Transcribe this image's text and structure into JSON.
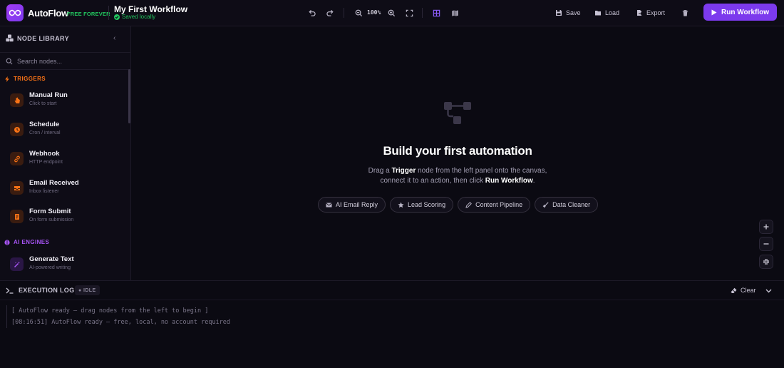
{
  "app": {
    "name": "AutoFlow",
    "tag": "FREE FOREVER"
  },
  "workflow": {
    "title": "My First Workflow",
    "status": "Saved locally"
  },
  "toolbar": {
    "zoom": "100%",
    "save": "Save",
    "load": "Load",
    "export": "Export",
    "run": "Run Workflow"
  },
  "sidebar": {
    "title": "NODE LIBRARY",
    "search_placeholder": "Search nodes...",
    "sections": [
      {
        "title": "TRIGGERS",
        "color": "#f97316",
        "nodes": [
          {
            "title": "Manual Run",
            "subtitle": "Click to start",
            "icon": "hand-pointer-icon"
          },
          {
            "title": "Schedule",
            "subtitle": "Cron / interval",
            "icon": "clock-icon"
          },
          {
            "title": "Webhook",
            "subtitle": "HTTP endpoint",
            "icon": "link-icon"
          },
          {
            "title": "Email Received",
            "subtitle": "Inbox listener",
            "icon": "inbox-icon"
          },
          {
            "title": "Form Submit",
            "subtitle": "On form submission",
            "icon": "form-icon"
          }
        ]
      },
      {
        "title": "AI ENGINES",
        "color": "#a855f7",
        "nodes": [
          {
            "title": "Generate Text",
            "subtitle": "AI-powered writing",
            "icon": "magic-wand-icon"
          }
        ]
      }
    ]
  },
  "canvas": {
    "empty_title": "Build your first automation",
    "desc_pre": "Drag a ",
    "desc_trigger": "Trigger",
    "desc_mid": " node from the left panel onto the canvas,",
    "desc_line2": "connect it to an action, then click ",
    "desc_run": "Run Workflow",
    "desc_end": ".",
    "templates": [
      {
        "label": "AI Email Reply",
        "icon": "envelope-icon"
      },
      {
        "label": "Lead Scoring",
        "icon": "star-icon"
      },
      {
        "label": "Content Pipeline",
        "icon": "pen-icon"
      },
      {
        "label": "Data Cleaner",
        "icon": "broom-icon"
      }
    ]
  },
  "log": {
    "title": "EXECUTION LOG",
    "status": "● IDLE",
    "clear": "Clear",
    "lines": [
      "[ AutoFlow ready — drag nodes from the left to begin ]",
      "[08:16:51] AutoFlow ready — free, local, no account required"
    ]
  },
  "colors": {
    "accent": "#7c3aed",
    "success": "#22c55e",
    "trigger": "#f97316",
    "ai": "#a855f7"
  }
}
